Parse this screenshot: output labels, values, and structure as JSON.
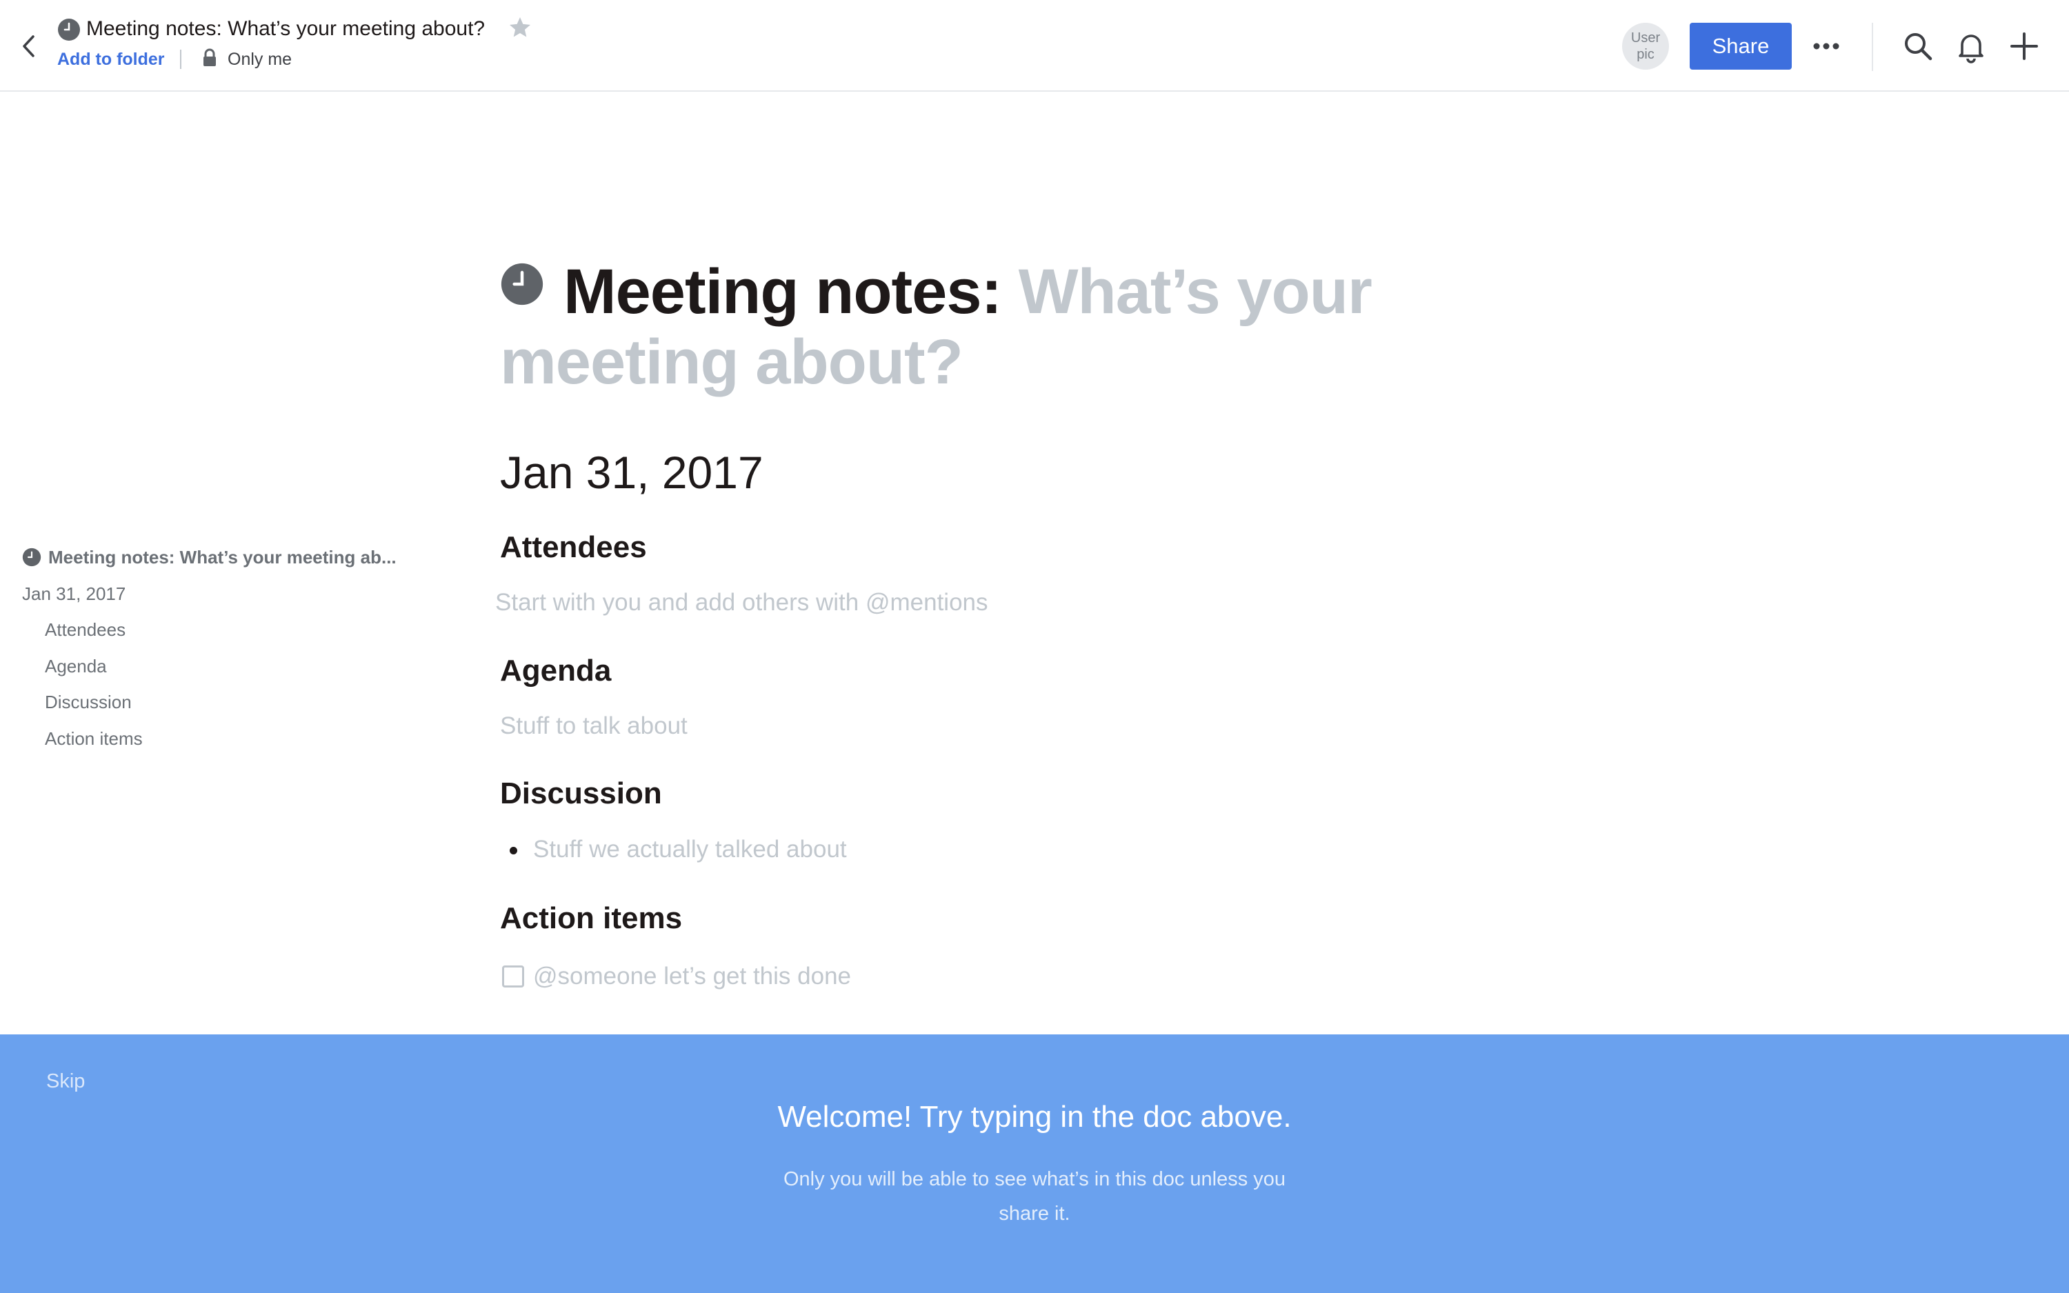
{
  "header": {
    "title": "Meeting notes: What’s your meeting about?",
    "add_to_folder": "Add to folder",
    "visibility": "Only me",
    "avatar_text": "User pic",
    "share_label": "Share"
  },
  "outline": {
    "title": "Meeting notes: What’s your meeting ab...",
    "items": [
      "Jan 31, 2017",
      "Attendees",
      "Agenda",
      "Discussion",
      "Action items"
    ]
  },
  "document": {
    "title_bold": "Meeting notes: ",
    "title_placeholder": "What’s your meeting about?",
    "date": "Jan 31, 2017",
    "sections": [
      {
        "heading": "Attendees",
        "placeholder": "Start with you and add others with @mentions"
      },
      {
        "heading": "Agenda",
        "placeholder": "Stuff to talk about"
      },
      {
        "heading": "Discussion",
        "placeholder": "Stuff we actually talked about"
      },
      {
        "heading": "Action items",
        "placeholder": "@someone let’s get this done"
      }
    ]
  },
  "banner": {
    "skip": "Skip",
    "title": "Welcome! Try typing in the doc above.",
    "subtitle": "Only you will be able to see what’s in this doc unless you share it."
  },
  "colors": {
    "accent": "#3d6fde",
    "banner": "#6aa1ee",
    "placeholder": "#c1c7cd",
    "text": "#1e1919"
  },
  "icons": {
    "back": "chevron-left-icon",
    "doc": "clock-icon",
    "star": "star-icon",
    "lock": "lock-icon",
    "more": "ellipsis-icon",
    "search": "search-icon",
    "bell": "bell-icon",
    "plus": "plus-icon",
    "checkbox": "checkbox-icon"
  }
}
